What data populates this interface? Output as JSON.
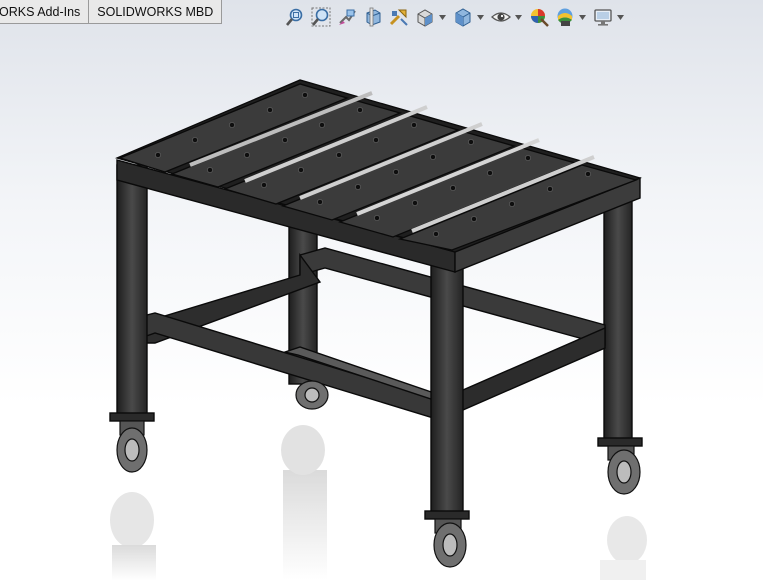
{
  "tabs": [
    {
      "label": "ORKS Add-Ins"
    },
    {
      "label": "SOLIDWORKS MBD"
    }
  ],
  "heads_up_toolbar": {
    "icons": [
      "zoom-to-fit-icon",
      "zoom-to-area-icon",
      "previous-view-icon",
      "section-view-icon",
      "dynamic-annotation-views-icon",
      "view-orientation-icon",
      "display-style-icon",
      "hide-show-items-icon",
      "edit-appearance-icon",
      "apply-scene-icon",
      "view-settings-icon"
    ]
  },
  "colors": {
    "model_body": "#2f2f2f",
    "model_edge": "#0a0a0a",
    "background_top": "#dfe3ea",
    "background_bottom": "#ffffff"
  }
}
